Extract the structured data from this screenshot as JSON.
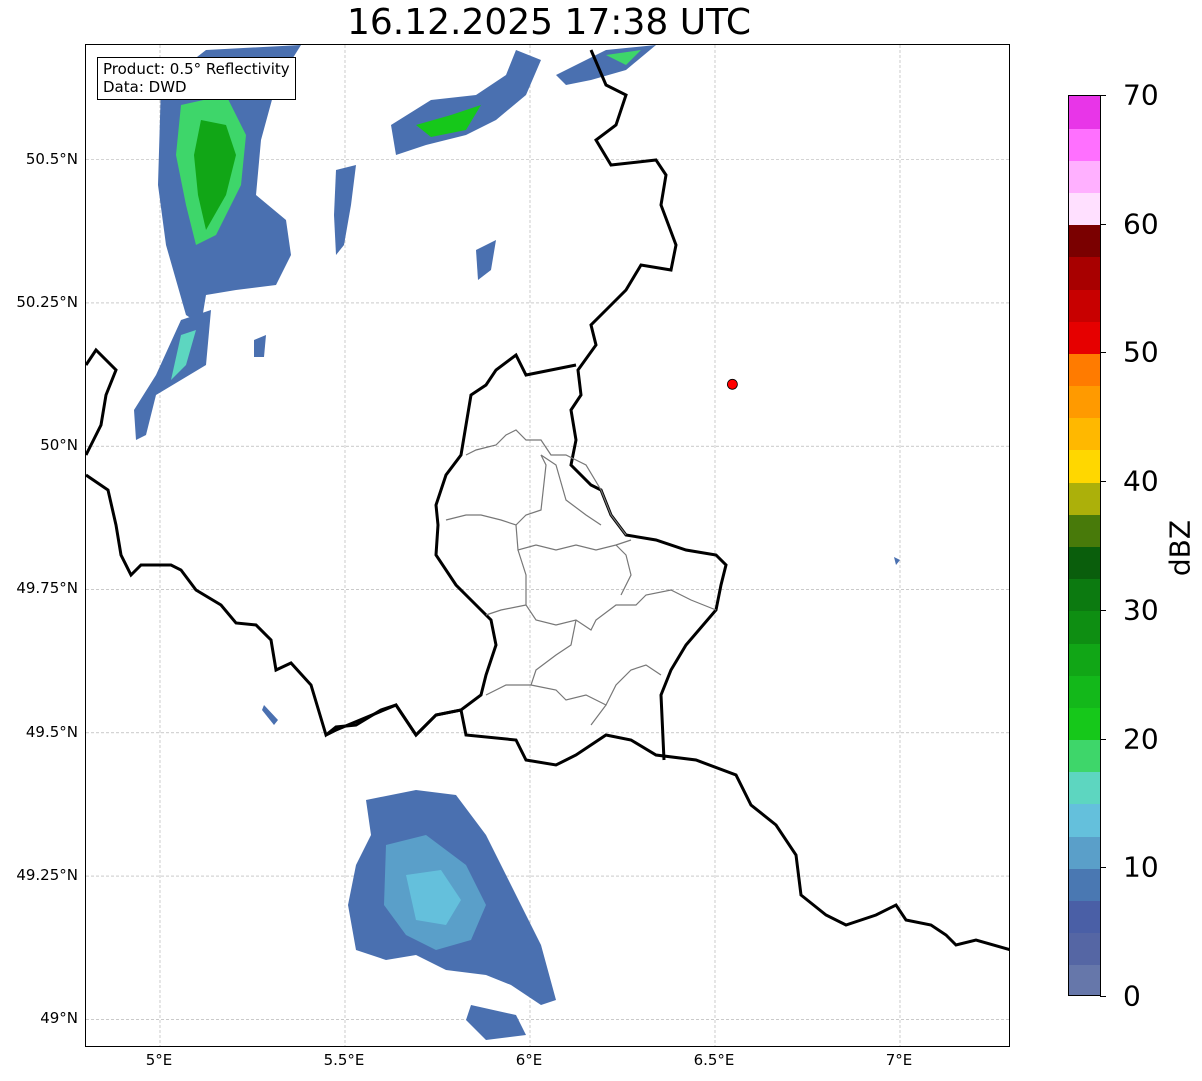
{
  "title": "16.12.2025 17:38 UTC",
  "info": {
    "product": "Product: 0.5° Reflectivity",
    "source": "Data: DWD"
  },
  "lat_ticks": [
    {
      "value": 50.5,
      "label": "50.5°N"
    },
    {
      "value": 50.25,
      "label": "50.25°N"
    },
    {
      "value": 50.0,
      "label": "50°N"
    },
    {
      "value": 49.75,
      "label": "49.75°N"
    },
    {
      "value": 49.5,
      "label": "49.5°N"
    },
    {
      "value": 49.25,
      "label": "49.25°N"
    },
    {
      "value": 49.0,
      "label": "49°N"
    }
  ],
  "lon_ticks": [
    {
      "value": 5.0,
      "label": "5°E"
    },
    {
      "value": 5.5,
      "label": "5.5°E"
    },
    {
      "value": 6.0,
      "label": "6°E"
    },
    {
      "value": 6.5,
      "label": "6.5°E"
    },
    {
      "value": 7.0,
      "label": "7°E"
    }
  ],
  "extent": {
    "lon_min": 4.8,
    "lon_max": 7.3,
    "lat_min": 48.95,
    "lat_max": 50.7
  },
  "marker": {
    "lon": 6.547,
    "lat": 50.108,
    "color": "#ff0000"
  },
  "colorbar": {
    "label": "dBZ",
    "min": 0,
    "max": 70,
    "ticks": [
      "0",
      "10",
      "20",
      "30",
      "40",
      "50",
      "60",
      "70"
    ],
    "colors": [
      "#6677aa",
      "#5566a4",
      "#4a5fa6",
      "#4a78b2",
      "#5a9fc9",
      "#64c0dc",
      "#5dd6c0",
      "#3ed66a",
      "#16c81a",
      "#13b81a",
      "#11a616",
      "#0e8e12",
      "#0c7a10",
      "#0a5e0c",
      "#487a0a",
      "#acb00a",
      "#ffd700",
      "#ffb800",
      "#ff9a00",
      "#ff7b00",
      "#e60000",
      "#c80000",
      "#a80000",
      "#7a0000",
      "#ffe0ff",
      "#ffb0ff",
      "#ff70ff",
      "#e835e8"
    ]
  }
}
